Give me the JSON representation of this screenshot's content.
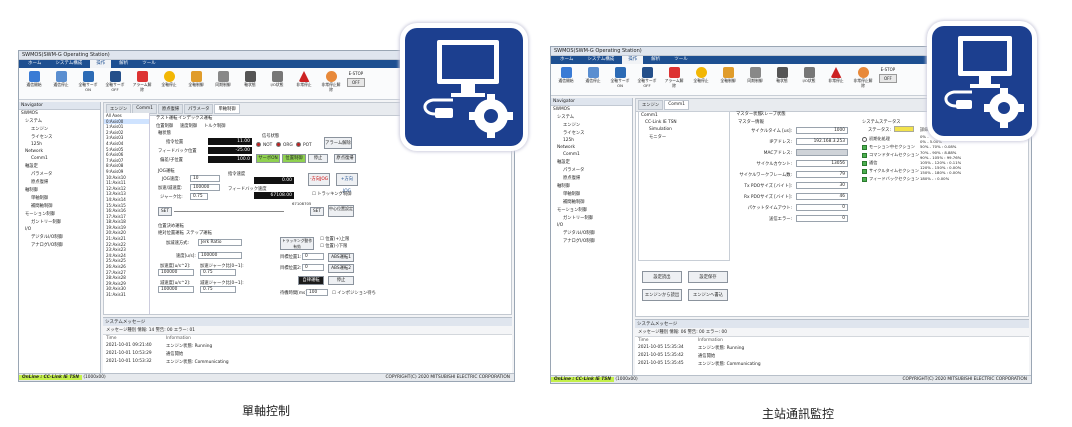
{
  "left": {
    "title": "SWMOS(SWM-G Operating Station)",
    "menu": [
      "ホーム",
      "システム構成",
      "操作",
      "解析",
      "ツール"
    ],
    "menu_active": 2,
    "ribbon": [
      {
        "label": "通信開始",
        "icon": "network-icon"
      },
      {
        "label": "通信停止",
        "icon": "network-stop-icon"
      },
      {
        "label": "全軸サーボON",
        "icon": "servo-on-icon"
      },
      {
        "label": "全軸サーボOFF",
        "icon": "servo-off-icon"
      },
      {
        "label": "アラーム解除",
        "icon": "alarm-clear-icon"
      },
      {
        "label": "全軸停止",
        "icon": "stop-icon"
      },
      {
        "label": "全軸制御",
        "icon": "control-icon"
      },
      {
        "label": "同期制御",
        "icon": "sync-icon"
      },
      {
        "label": "軸状態",
        "icon": "axis-state-icon"
      },
      {
        "label": "I/O状態",
        "icon": "io-icon"
      },
      {
        "label": "非常停止",
        "icon": "warning-icon"
      },
      {
        "label": "非常停止解除",
        "icon": "estop-release-icon"
      }
    ],
    "ribbon_groups": [
      "ネットワーク操作",
      "全軸操作",
      "全軸状態",
      "非常停止"
    ],
    "estop_label": "E-STOP",
    "estop_value": "OFF",
    "navigator_title": "Navigator",
    "tree": [
      "SWMOS",
      "システム",
      "エンジン",
      "ライセンス",
      "125h",
      "Network",
      "Comm1",
      "軸設定",
      "パラメータ",
      "原点復帰",
      "軸制御",
      "単軸制御",
      "補間軸制御",
      "モーション制御",
      "ガントリー制御",
      "I/O",
      "デジタルI/O制御",
      "アナログI/O制御"
    ],
    "tabs": [
      "エンジン",
      "Comm1",
      "原点復帰",
      "パラメータ",
      "単軸制御"
    ],
    "axes": [
      "All Axes",
      "0:Axis00",
      "1:Axis01",
      "2:Axis02",
      "3:Axis03",
      "4:Axis04",
      "5:Axis05",
      "6:Axis06",
      "7:Axis07",
      "8:Axis08",
      "9:Axis09",
      "10:Axis10",
      "11:Axis11",
      "12:Axis12",
      "13:Axis13",
      "14:Axis14",
      "15:Axis15",
      "16:Axis16",
      "17:Axis17",
      "18:Axis18",
      "19:Axis19",
      "20:Axis20",
      "21:Axis21",
      "22:Axis22",
      "23:Axis23",
      "24:Axis24",
      "25:Axis25",
      "26:Axis26",
      "27:Axis27",
      "28:Axis28",
      "29:Axis29",
      "30:Axis30",
      "31:Axis31"
    ],
    "subtabs": [
      "テスト運転",
      "インデックス運転"
    ],
    "section_tabs": [
      "位置制御",
      "速度制御",
      "トルク制御"
    ],
    "axis_state_label": "軸状態",
    "cmd_pos_label": "指令位置",
    "cmd_pos": "11.00",
    "fb_pos_label": "フィードバック位置",
    "fb_pos": "-25.00",
    "deviation_label": "偏差/子位置",
    "deviation": "100.0",
    "signal_label": "信号状態",
    "signals": [
      "NOT",
      "ORG",
      "POT"
    ],
    "alarm_clear": "アラーム解除",
    "servo_on": "サーボON",
    "pos_control": "位置制御",
    "stop": "停止",
    "home_return": "原点復帰",
    "jog_title": "JOG運転",
    "jog_speed_label": "JOG速度:",
    "jog_speed": "10",
    "acc_label": "加速/減速度:",
    "acc": "100000",
    "jerk_label": "ジャーク比:",
    "jerk": "0.75",
    "cmd_speed_label": "指令速度",
    "cmd_speed": "0.00",
    "fb_speed_label": "フィードバック速度",
    "fb_speed": "67108.00",
    "jog_neg": "-方向JOG",
    "jog_pos": "+方向JOG",
    "trigger_label": "トラッキング制御",
    "trigger_value": "67108705",
    "set": "SET",
    "set2": "SET",
    "center_pos": "中心位置設定",
    "pos_move_title": "位置決め運転",
    "abs_tabs": [
      "絶対位置運転",
      "ステップ運転"
    ],
    "profile_label": "加減速方式:",
    "profile_value": "Jerk Ratio",
    "speed_label": "速度[u/s]:",
    "speed": "100000",
    "accel_label": "加速度[u/s^2]:",
    "accel": "100000",
    "accel_jerk_label": "加速ジャーク比[0~1]:",
    "accel_jerk": "0.75",
    "decel_label": "減速度[u/s^2]:",
    "decel": "100000",
    "decel_jerk_label": "減速ジャーク比[0~1]:",
    "decel_jerk": "0.75",
    "tracking_label": "トラッキング動作有効",
    "target1_label": "目標位置1:",
    "target1": "0",
    "target2_label": "目標位置2:",
    "target2": "0",
    "limit_upper": "位置(+)上限",
    "limit_lower": "位置(-)下限",
    "abs_move1": "ABS運転1",
    "abs_move2": "ABS運転2",
    "auto_run": "自律運転",
    "stop2": "停止",
    "wait_label": "待機時間[ms]:",
    "wait": "100",
    "interp_label": "インポジション待ち",
    "sysmsg_title": "システムメッセージ",
    "msg_toolbar": "メッセージ種別 情報: 14  警告: 00  エラー: 01",
    "msg_cols": [
      "Time",
      "Information"
    ],
    "messages": [
      {
        "time": "2021-10-01 09:21:40",
        "info": "エンジン状態: Running"
      },
      {
        "time": "2021-10-01 10:53:29",
        "info": "通信開始"
      },
      {
        "time": "2021-10-01 10:53:32",
        "info": "エンジン状態: Communicating"
      }
    ],
    "status_online": "OnLine : CC-Link IE TSN",
    "status_id": "(1000x00)",
    "copyright": "COPYRIGHT(C) 2020 MITSUBISHI ELECTRIC CORPORATION"
  },
  "right": {
    "title": "SWMOS(SWM-G Operating Station)",
    "menu": [
      "ホーム",
      "システム構成",
      "操作",
      "解析",
      "ツール"
    ],
    "menu_active": 2,
    "navigator_title": "Navigator",
    "tree": [
      "SWMOS",
      "システム",
      "エンジン",
      "ライセンス",
      "125h",
      "Network",
      "Comm1",
      "軸設定",
      "パラメータ",
      "原点復帰",
      "軸制御",
      "単軸制御",
      "補間軸制御",
      "モーション制御",
      "ガントリー制御",
      "I/O",
      "デジタルI/O制御",
      "アナログI/O制御"
    ],
    "tabs": [
      "エンジン",
      "Comm1"
    ],
    "network_tree": [
      "Comm1",
      "CC-Link IE TSN",
      "Simulation",
      "モニター"
    ],
    "subtabs": [
      "マスター状態",
      "スレーブ状態"
    ],
    "master_title": "マスター情報",
    "fields": [
      {
        "label": "サイクルタイム [us]:",
        "value": "1000"
      },
      {
        "label": "IPアドレス:",
        "value": "192.168.3.253"
      },
      {
        "label": "MACアドレス:",
        "value": ""
      },
      {
        "label": "サイクルカウント:",
        "value": "13056"
      },
      {
        "label": "サイクルワークフレーム数:",
        "value": "79"
      },
      {
        "label": "Tx PDOサイズ [バイト]:",
        "value": "30"
      },
      {
        "label": "Rx PDOサイズ [バイト]:",
        "value": "46"
      },
      {
        "label": "パケットタイムアウト:",
        "value": "0"
      },
      {
        "label": "送信エラー:",
        "value": "0"
      }
    ],
    "sysstat_title": "システムステータス",
    "sysstat_label": "ステータス:",
    "sysstat_items": [
      "初期化処理",
      "モーション中セクション",
      "コマンドタイムセクション",
      "通信",
      "サイクルタイムセクション",
      "フィードバックセクション"
    ],
    "detail_title": "詳細",
    "detail_rows": [
      "0% -",
      "0% - 5.00%",
      "50% - 70% : 0.08%",
      "70% - 90% : 8.88%",
      "90% - 105% : 99.76%",
      "105% - 120% : 0.11%",
      "120% - 150% : 0.00%",
      "150% - 180% : 0.00%",
      "180% - : 0.00%"
    ],
    "btns": [
      "設定読出",
      "設定保存",
      "エンジンから読出",
      "エンジンへ書込"
    ],
    "sysmsg_title": "システムメッセージ",
    "msg_toolbar": "メッセージ種別 情報: 06  警告: 00  エラー: 00",
    "msg_cols": [
      "Time",
      "Information"
    ],
    "messages": [
      {
        "time": "2021-10-05 15:35:34",
        "info": "エンジン状態: Running"
      },
      {
        "time": "2021-10-05 15:35:42",
        "info": "通信開始"
      },
      {
        "time": "2021-10-05 15:35:45",
        "info": "エンジン状態: Communicating"
      }
    ],
    "status_online": "OnLine : CC-Link IE TSN",
    "status_id": "(1000x00)",
    "copyright": "COPYRIGHT(C) 2020 MITSUBISHI ELECTRIC CORPORATION"
  },
  "captions": {
    "left": "單軸控制",
    "right": "主站通訊監控"
  },
  "colors": {
    "menu": "#1d4f91",
    "badge": "#1c3f8f",
    "online": "#c4f04a",
    "servo_on": "#8fd14f"
  }
}
